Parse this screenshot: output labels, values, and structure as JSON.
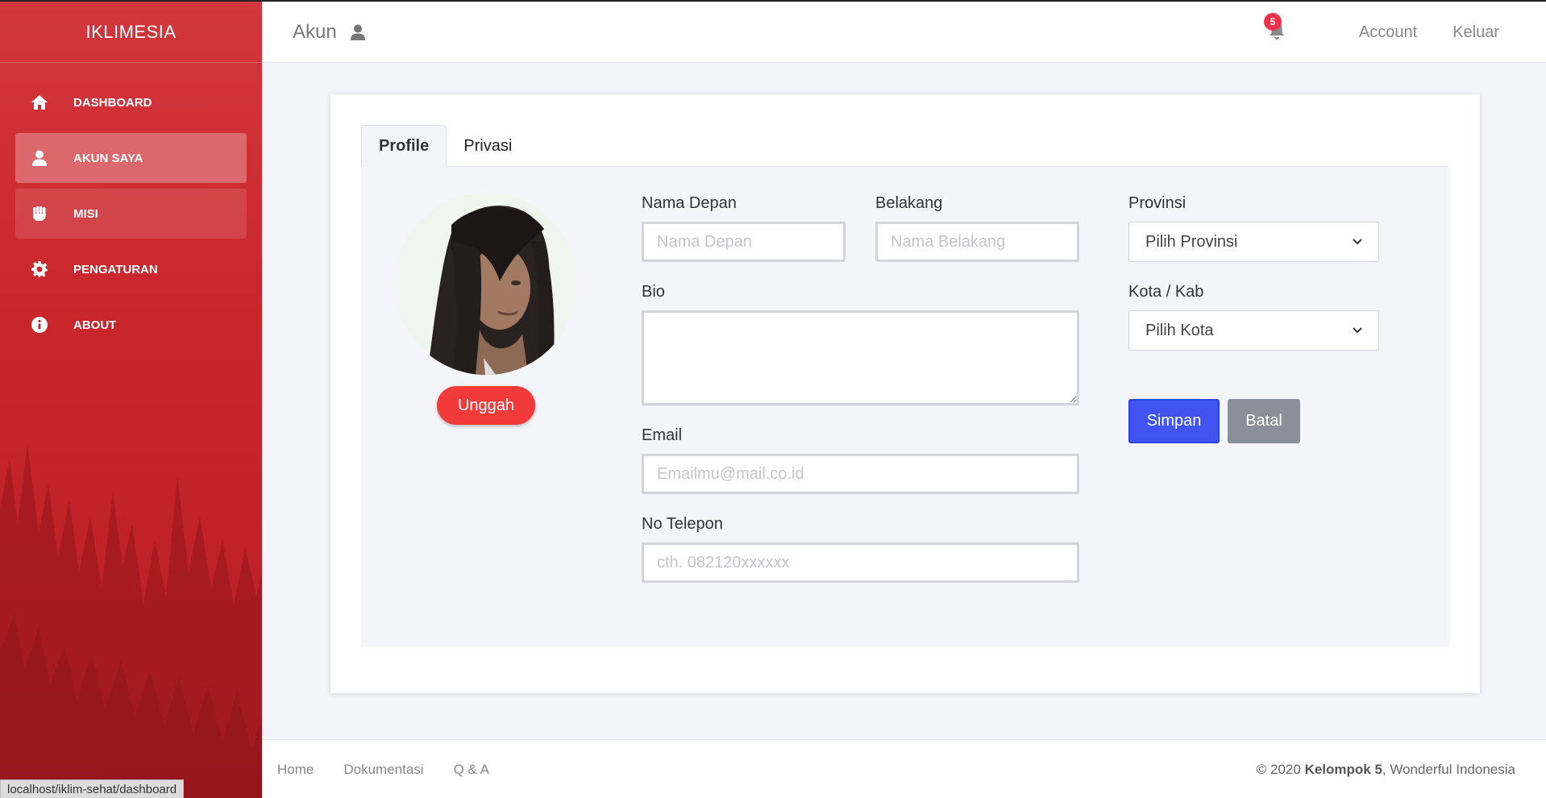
{
  "sidebar": {
    "brand": "IKLIMESIA",
    "items": [
      {
        "label": "DASHBOARD",
        "icon": "home-icon"
      },
      {
        "label": "AKUN SAYA",
        "icon": "user-icon"
      },
      {
        "label": "MISI",
        "icon": "fist-icon"
      },
      {
        "label": "PENGATURAN",
        "icon": "gear-icon"
      },
      {
        "label": "ABOUT",
        "icon": "info-icon"
      }
    ]
  },
  "header": {
    "title": "Akun",
    "notification_count": "5",
    "links": [
      "Account",
      "Keluar"
    ]
  },
  "tabs": [
    {
      "label": "Profile",
      "active": true
    },
    {
      "label": "Privasi",
      "active": false
    }
  ],
  "profile": {
    "upload_label": "Unggah",
    "first_name": {
      "label": "Nama Depan",
      "placeholder": "Nama Depan"
    },
    "last_name": {
      "label": "Belakang",
      "placeholder": "Nama Belakang"
    },
    "bio": {
      "label": "Bio"
    },
    "email": {
      "label": "Email",
      "placeholder": "Emailmu@mail.co.id"
    },
    "phone": {
      "label": "No Telepon",
      "placeholder": "cth. 082120xxxxxx"
    },
    "province": {
      "label": "Provinsi",
      "selected": "Pilih Provinsi"
    },
    "city": {
      "label": "Kota / Kab",
      "selected": "Pilih Kota"
    },
    "save_label": "Simpan",
    "cancel_label": "Batal"
  },
  "footer": {
    "links": [
      "Home",
      "Dokumentasi",
      "Q & A"
    ],
    "copyright_prefix": "© 2020 ",
    "copyright_team": "Kelompok 5",
    "copyright_suffix": ", Wonderful Indonesia"
  },
  "status_url": "localhost/iklim-sehat/dashboard",
  "colors": {
    "sidebar": "#c9262c",
    "primary": "#4154f1",
    "upload": "#f23a3a",
    "cancel": "#8a9099",
    "badge": "#f0334b"
  }
}
